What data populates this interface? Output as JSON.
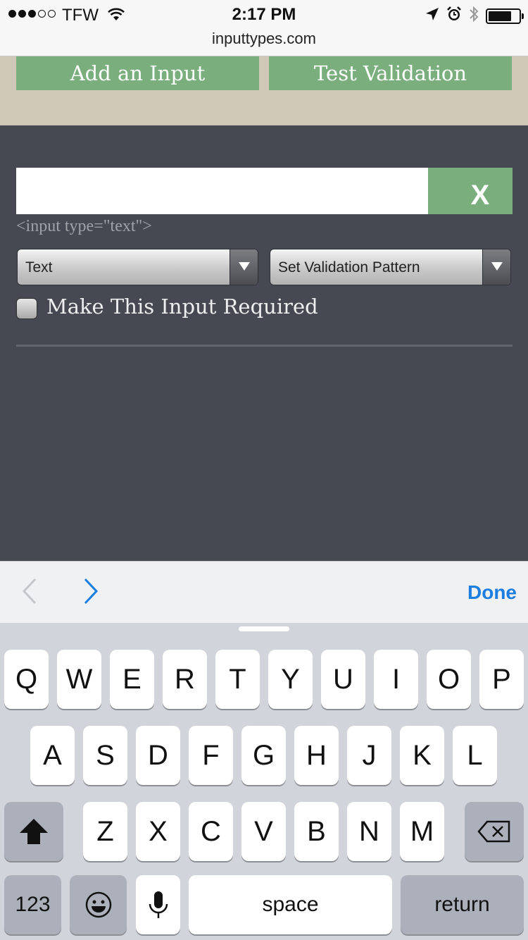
{
  "status_bar": {
    "carrier": "TFW",
    "time": "2:17 PM",
    "url": "inputtypes.com",
    "signal_bars_filled": 3,
    "signal_bars_total": 5,
    "battery_level": 0.75
  },
  "top_buttons": {
    "add_input": "Add an Input",
    "test_validation": "Test Validation"
  },
  "form": {
    "text_input_value": "",
    "clear_button_label": "X",
    "code_label": "<input type=\"text\">",
    "type_select": "Text",
    "pattern_select": "Set Validation Pattern",
    "required_label": "Make This Input Required",
    "required_checked": false
  },
  "accessory_bar": {
    "done_label": "Done"
  },
  "keyboard": {
    "row1": [
      "Q",
      "W",
      "E",
      "R",
      "T",
      "Y",
      "U",
      "I",
      "O",
      "P"
    ],
    "row2": [
      "A",
      "S",
      "D",
      "F",
      "G",
      "H",
      "J",
      "K",
      "L"
    ],
    "row3": [
      "Z",
      "X",
      "C",
      "V",
      "B",
      "N",
      "M"
    ],
    "numbers_key": "123",
    "space_key": "space",
    "return_key": "return"
  },
  "colors": {
    "accent_green": "#7aae7d",
    "dark_bg": "#464951",
    "beige": "#cfc8b6",
    "done_blue": "#1b7ee0"
  },
  "icons": [
    "wifi-icon",
    "location-arrow-icon",
    "alarm-icon",
    "bluetooth-icon",
    "battery-icon",
    "chevron-left-icon",
    "chevron-right-icon",
    "shift-icon",
    "delete-icon",
    "emoji-icon",
    "microphone-icon",
    "dropdown-arrow-icon"
  ]
}
